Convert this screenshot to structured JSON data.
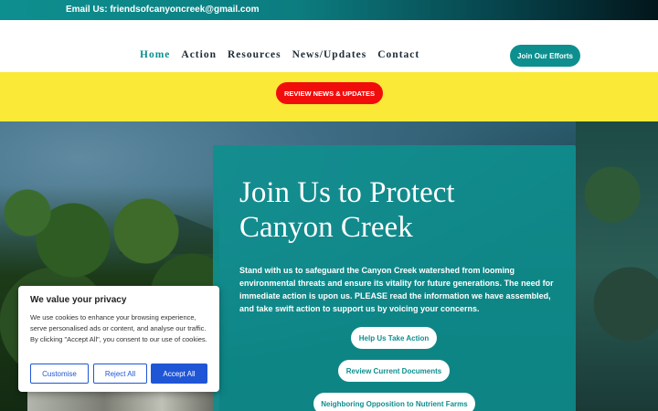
{
  "topbar": {
    "email_text": "Email Us: friendsofcanyoncreek@gmail.com"
  },
  "nav": {
    "items": [
      {
        "label": "Home",
        "active": true
      },
      {
        "label": "Action"
      },
      {
        "label": "Resources"
      },
      {
        "label": "News/Updates"
      },
      {
        "label": "Contact"
      }
    ],
    "cta_label": "Join Our Efforts"
  },
  "banner": {
    "button_label": "REVIEW NEWS & UPDATES"
  },
  "hero": {
    "title": "Join Us to Protect Canyon Creek",
    "body": "Stand with us to safeguard the Canyon Creek watershed from looming environmental threats and ensure its vitality for future generations. The need for immediate action is upon us. PLEASE read the information we have assembled, and take swift action to support us by voicing your concerns.",
    "buttons": [
      {
        "label": "Help Us Take Action"
      },
      {
        "label": "Review Current Documents"
      },
      {
        "label": "Neighboring Opposition to Nutrient Farms"
      }
    ]
  },
  "cookie": {
    "title": "We value your privacy",
    "text": "We use cookies to enhance your browsing experience, serve personalised ads or content, and analyse our traffic. By clicking \"Accept All\", you consent to our use of cookies.",
    "customise_label": "Customise",
    "reject_label": "Reject All",
    "accept_label": "Accept All"
  },
  "colors": {
    "teal": "#0e8f8f",
    "banner_yellow": "#fbe938",
    "banner_button_red": "#f20d0d",
    "cookie_blue": "#1f56d6"
  }
}
